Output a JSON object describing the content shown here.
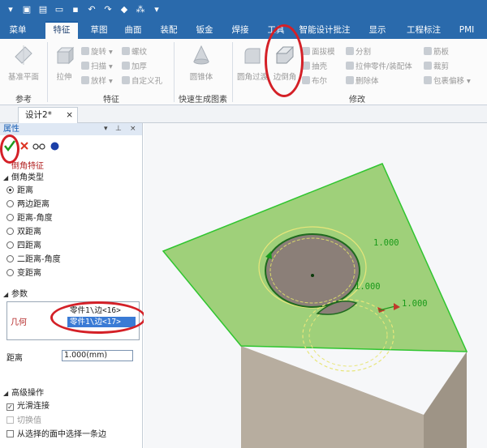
{
  "tabs": [
    "菜单",
    "特征",
    "草图",
    "曲面",
    "装配",
    "钣金",
    "焊接",
    "工具",
    "智能设计批注",
    "显示",
    "工程标注",
    "PMI"
  ],
  "active_tab": "特征",
  "ribbon": {
    "ref_group": {
      "label": "参考",
      "btn": "基准平面"
    },
    "feature_group": {
      "label": "特征",
      "btn": "拉伸",
      "small": [
        "旋转",
        "螺纹",
        "扫描",
        "加厚",
        "放样",
        "自定义孔"
      ]
    },
    "quick_group": {
      "label": "快速生成图素",
      "btn": "圆锥体"
    },
    "modify_group": {
      "label": "修改",
      "btn1": "圆角过渡",
      "btn2": "边倒角",
      "small": [
        "面拔模",
        "分割",
        "抽壳",
        "拉伸零件/装配体",
        "布尔",
        "删除体"
      ],
      "small2": [
        "筋板",
        "裁剪",
        "包裹偏移"
      ]
    }
  },
  "doc_tab": "设计2*",
  "panel": {
    "title": "属性",
    "feature_title": "倒角特征",
    "chamfer_type_label": "倒角类型",
    "types": [
      "距离",
      "两边距离",
      "距离-角度",
      "双距离",
      "四距离",
      "二距离-角度",
      "变距离"
    ],
    "selected_type": "距离",
    "params_label": "参数",
    "geometry_label": "几何",
    "geometry_items": [
      "零件1\\边<16>",
      "零件1\\边<17>"
    ],
    "distance_label": "距离",
    "distance_value": "1.000(mm)",
    "advanced_label": "高级操作",
    "smooth_label": "光滑连接",
    "switch_label": "切换值",
    "select_face_label": "从选择的面中选择一条边"
  },
  "viewport": {
    "dims": [
      "1.000",
      "1.000",
      "1.000"
    ]
  },
  "colors": {
    "top_bar": "#2a6aac",
    "highlight_ellipse": "#d42027",
    "top_face": "#9fd07a",
    "side_face": "#b7ad9f",
    "dimension": "#1a9a1a"
  }
}
